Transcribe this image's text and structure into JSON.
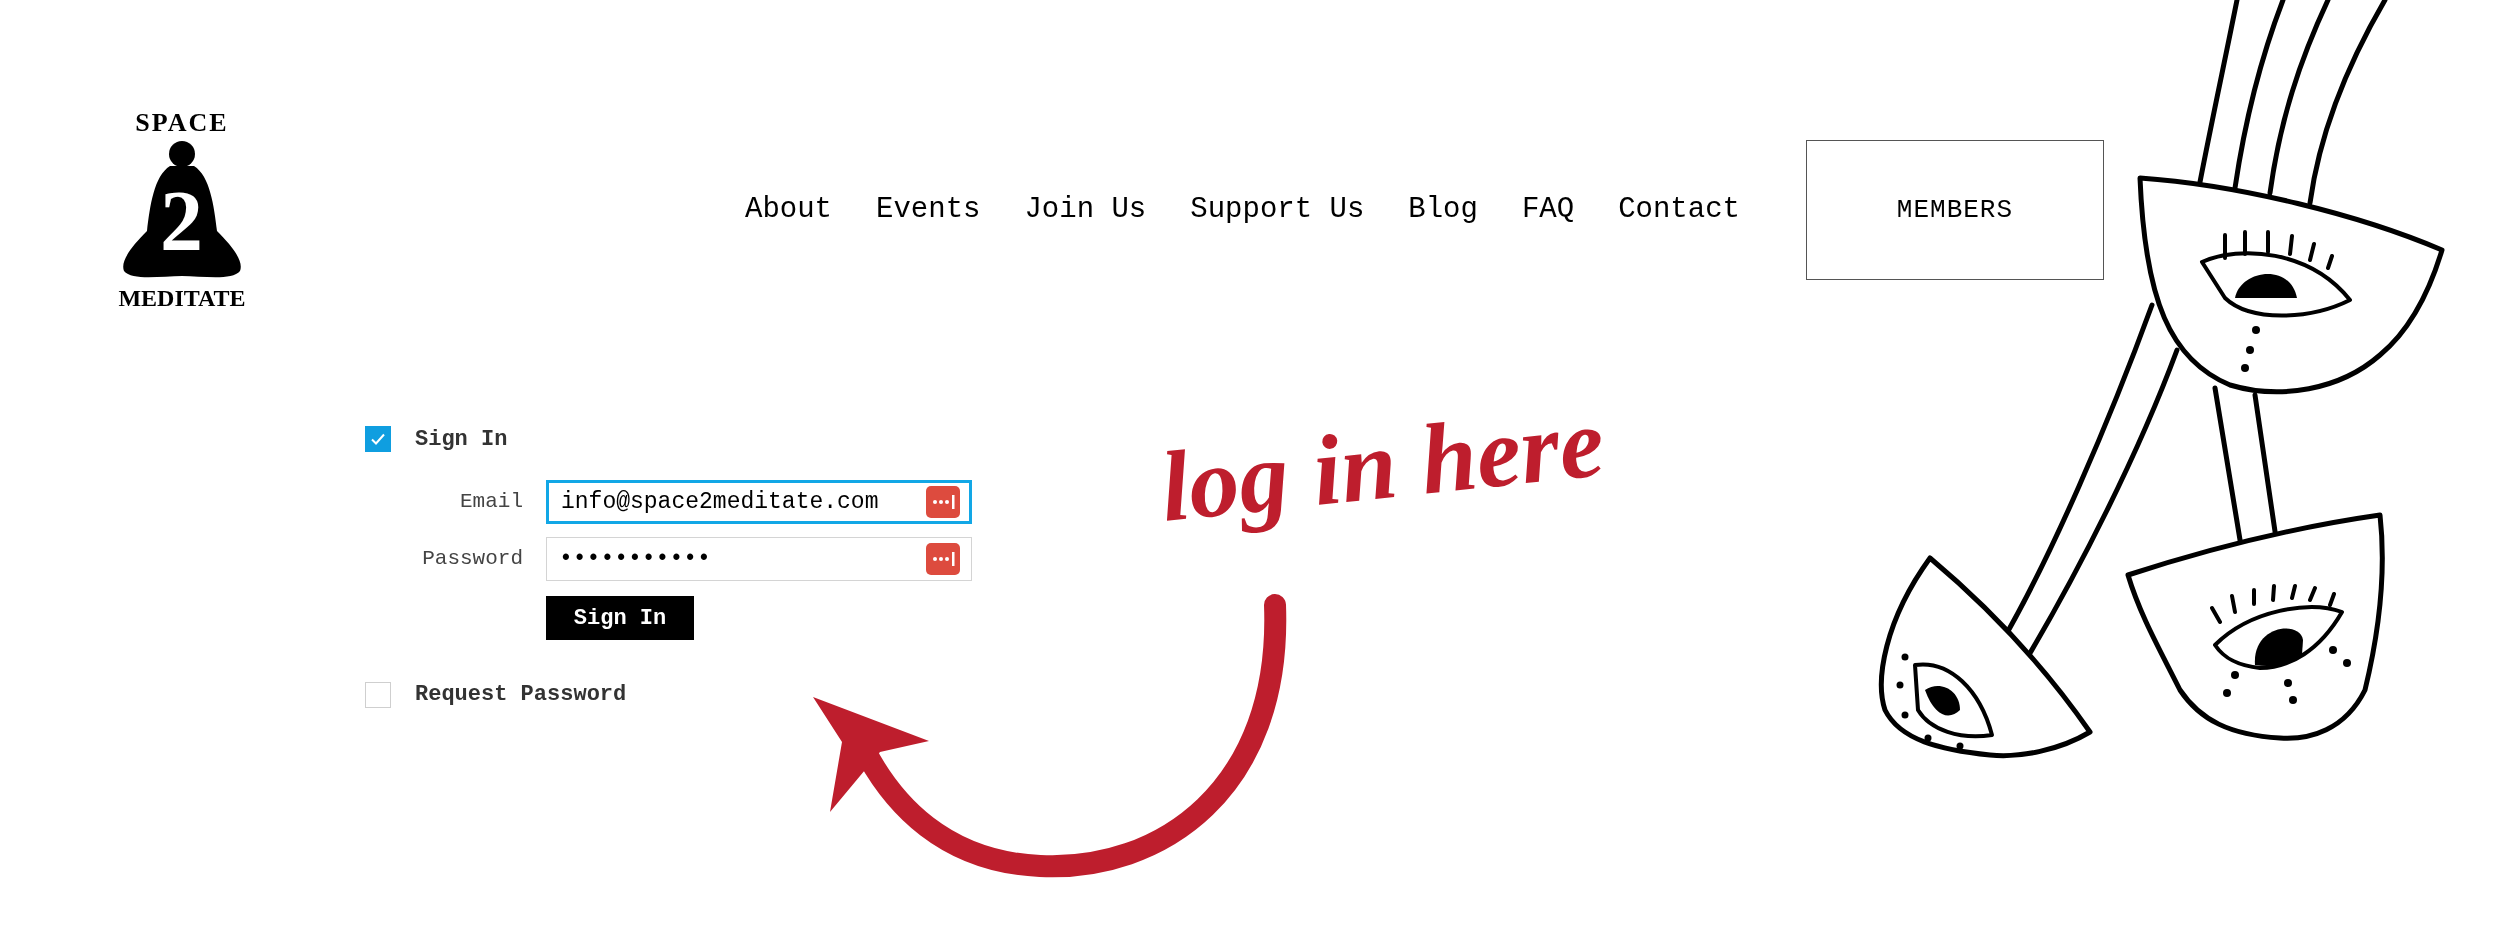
{
  "logo": {
    "top": "SPACE",
    "numeral": "2",
    "bottom": "MEDITATE"
  },
  "nav": {
    "items": [
      "About",
      "Events",
      "Join Us",
      "Support Us",
      "Blog",
      "FAQ",
      "Contact"
    ],
    "members_button": "MEMBERS"
  },
  "login": {
    "sign_in_option": {
      "label": "Sign In",
      "checked": true
    },
    "fields": [
      {
        "label": "Email",
        "value": "info@space2meditate.com",
        "focused": true
      },
      {
        "label": "Password",
        "value": "•••••••••••",
        "focused": false
      }
    ],
    "submit": "Sign In",
    "request_option": {
      "label": "Request Password",
      "checked": false
    }
  },
  "annotation": {
    "text": "log in here"
  }
}
